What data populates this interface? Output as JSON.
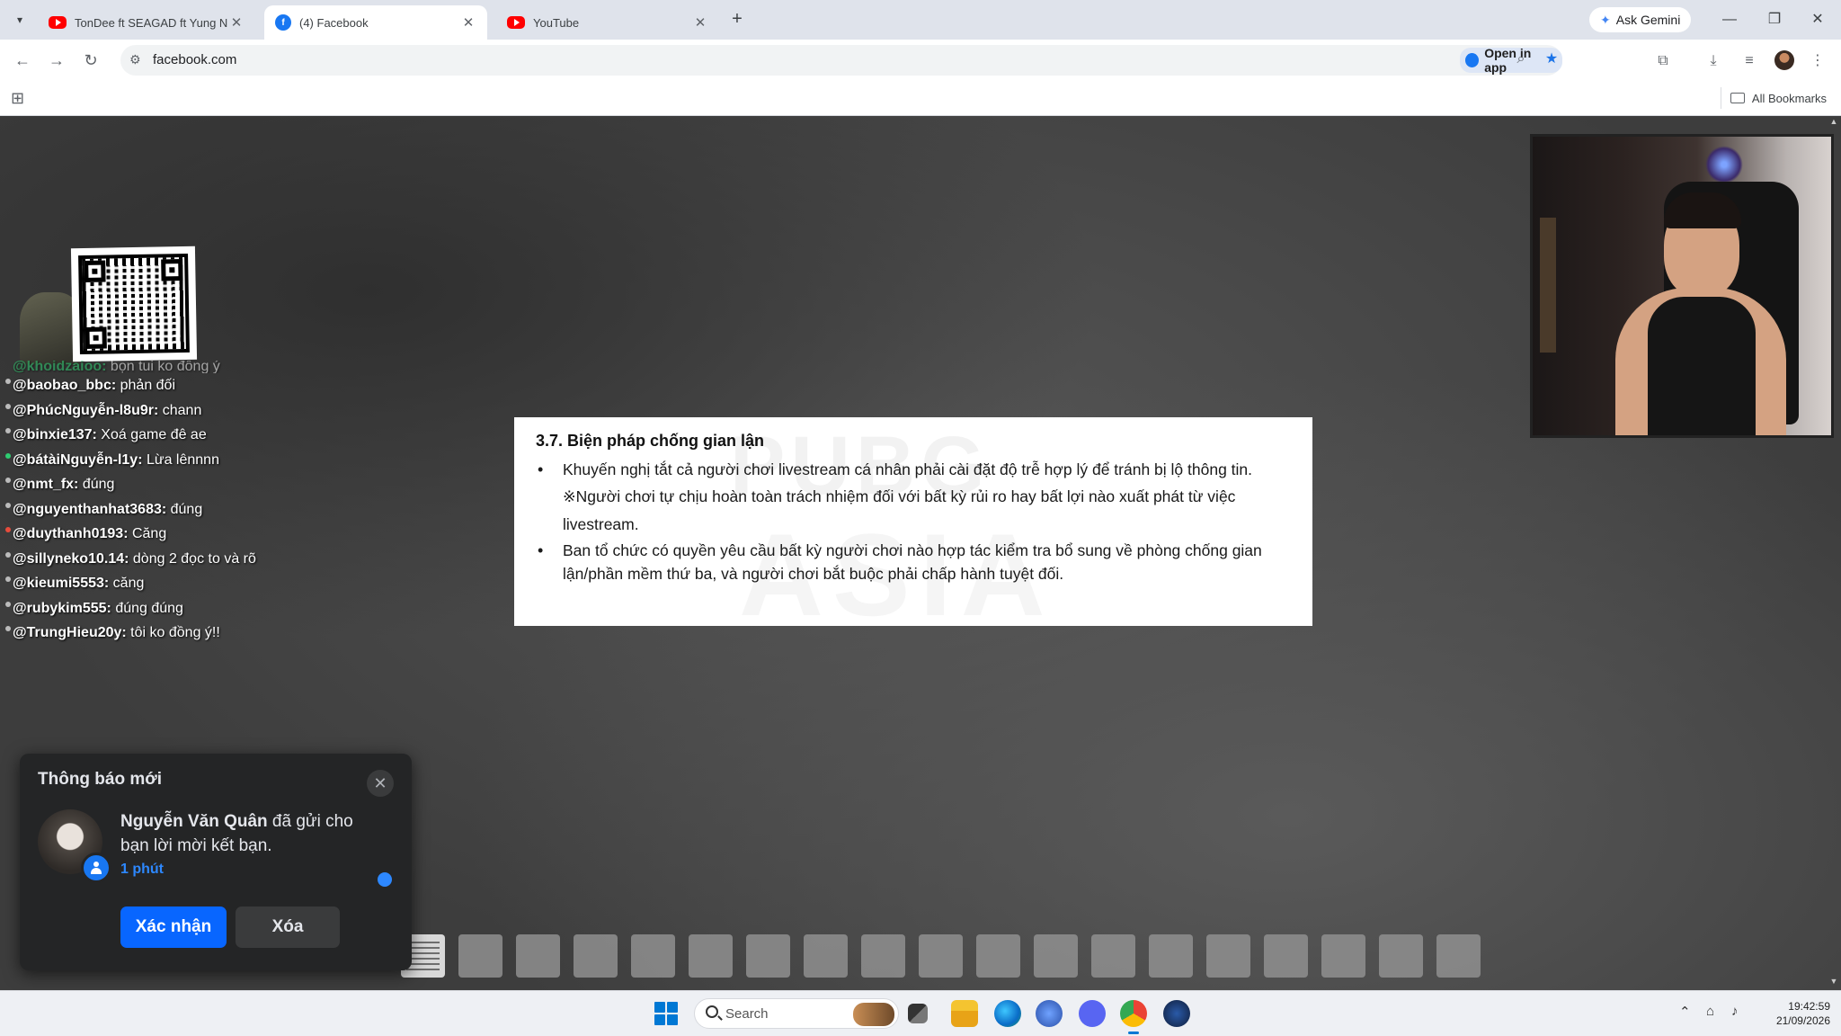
{
  "browser": {
    "tabs": [
      {
        "title": "TonDee ft SEAGAD ft Yung Ni",
        "icon": "youtube-icon",
        "active": false
      },
      {
        "title": "(4) Facebook",
        "icon": "facebook-icon",
        "active": true
      },
      {
        "title": "YouTube",
        "icon": "youtube-icon",
        "active": false
      }
    ],
    "new_tab": "+",
    "ask_gemini": "Ask Gemini",
    "url": "facebook.com",
    "open_in_app": "Open in app",
    "all_bookmarks": "All Bookmarks"
  },
  "stream": {
    "chat": [
      {
        "user": "@khoidzaioo:",
        "msg": " bọn tui ko đồng ý"
      },
      {
        "user": "@baobao_bbc:",
        "msg": " phản đối"
      },
      {
        "user": "@PhúcNguyễn-l8u9r:",
        "msg": " chann"
      },
      {
        "user": "@binxie137:",
        "msg": " Xoá game đê ae"
      },
      {
        "user": "@bátàiNguyễn-l1y:",
        "msg": " Lừa lênnnn"
      },
      {
        "user": "@nmt_fx:",
        "msg": " đúng"
      },
      {
        "user": "@nguyenthanhat3683:",
        "msg": " đúng"
      },
      {
        "user": "@duythanh0193:",
        "msg": " Căng"
      },
      {
        "user": "@sillyneko10.14:",
        "msg": " dòng 2 đọc to và rõ"
      },
      {
        "user": "@kieumi5553:",
        "msg": " căng"
      },
      {
        "user": "@rubykim555:",
        "msg": " đúng đúng"
      },
      {
        "user": "@TrungHieu20y:",
        "msg": " tôi ko đồng ý!!"
      }
    ],
    "document": {
      "heading": "3.7. Biện pháp chống gian lận",
      "bullet1": "Khuyến nghị tắt cả người chơi livestream cá nhân phải cài đặt độ trễ hợp lý để tránh bị lộ thông tin.",
      "note": "※Người chơi tự chịu hoàn toàn trách nhiệm đối với bất kỳ rủi ro hay bất lợi nào xuất phát từ việc livestream.",
      "bullet2": "Ban tổ chức có quyền yêu cầu bất kỳ người chơi nào hợp tác kiểm tra bổ sung về phòng chống gian lận/phần mềm thứ ba, và người chơi bắt buộc phải chấp hành tuyệt đối.",
      "watermark_top": "PUBG",
      "watermark_bottom": "ASIA"
    }
  },
  "notification": {
    "title": "Thông báo mới",
    "name": "Nguyễn Văn Quân",
    "message": " đã gửi cho bạn lời mời kết bạn.",
    "time": "1 phút",
    "confirm": "Xác nhận",
    "delete": "Xóa"
  },
  "taskbar": {
    "search": "Search",
    "time": "19:42:59",
    "date": "21/09/2026"
  },
  "colors": {
    "facebook_blue": "#0866ff",
    "notif_bg": "#242526",
    "link_blue": "#2d88ff"
  }
}
